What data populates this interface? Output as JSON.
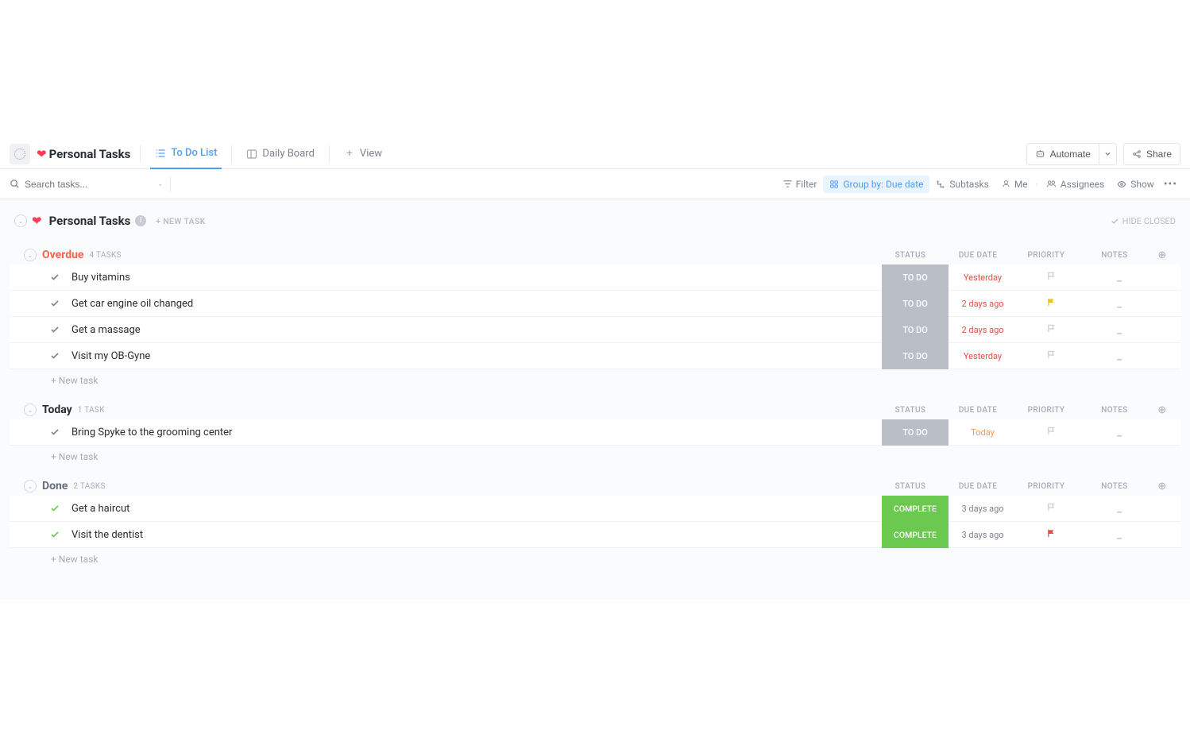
{
  "header": {
    "title": "Personal Tasks",
    "tabs": [
      {
        "label": "To Do List",
        "icon": "list-icon",
        "active": true
      },
      {
        "label": "Daily Board",
        "icon": "board-icon",
        "active": false
      },
      {
        "label": "View",
        "icon": "plus-icon",
        "active": false
      }
    ],
    "automate_label": "Automate",
    "share_label": "Share"
  },
  "filter_row": {
    "search_placeholder": "Search tasks...",
    "filter_label": "Filter",
    "group_by_label": "Group by: Due date",
    "subtasks_label": "Subtasks",
    "me_label": "Me",
    "assignees_label": "Assignees",
    "show_label": "Show"
  },
  "list": {
    "title": "Personal Tasks",
    "new_task_label": "+ NEW TASK",
    "hide_closed_label": "HIDE CLOSED",
    "columns": {
      "status": "STATUS",
      "due": "DUE DATE",
      "priority": "PRIORITY",
      "notes": "NOTES"
    },
    "new_task_row": "+ New task",
    "groups": [
      {
        "title": "Overdue",
        "title_class": "overdue",
        "count_label": "4 TASKS",
        "tasks": [
          {
            "name": "Buy vitamins",
            "status": "TO DO",
            "status_class": "status-todo",
            "due": "Yesterday",
            "due_class": "red",
            "priority": "none",
            "done": false
          },
          {
            "name": "Get car engine oil changed",
            "status": "TO DO",
            "status_class": "status-todo",
            "due": "2 days ago",
            "due_class": "red",
            "priority": "yellow",
            "done": false
          },
          {
            "name": "Get a massage",
            "status": "TO DO",
            "status_class": "status-todo",
            "due": "2 days ago",
            "due_class": "red",
            "priority": "none",
            "done": false
          },
          {
            "name": "Visit my OB-Gyne",
            "status": "TO DO",
            "status_class": "status-todo",
            "due": "Yesterday",
            "due_class": "red",
            "priority": "none",
            "done": false
          }
        ]
      },
      {
        "title": "Today",
        "title_class": "",
        "count_label": "1 TASK",
        "tasks": [
          {
            "name": "Bring Spyke to the grooming center",
            "status": "TO DO",
            "status_class": "status-todo",
            "due": "Today",
            "due_class": "orange",
            "priority": "none",
            "done": false
          }
        ]
      },
      {
        "title": "Done",
        "title_class": "done",
        "count_label": "2 TASKS",
        "tasks": [
          {
            "name": "Get a haircut",
            "status": "COMPLETE",
            "status_class": "status-complete",
            "due": "3 days ago",
            "due_class": "grey",
            "priority": "none",
            "done": true
          },
          {
            "name": "Visit the dentist",
            "status": "COMPLETE",
            "status_class": "status-complete",
            "due": "3 days ago",
            "due_class": "grey",
            "priority": "red",
            "done": true
          }
        ]
      }
    ]
  }
}
